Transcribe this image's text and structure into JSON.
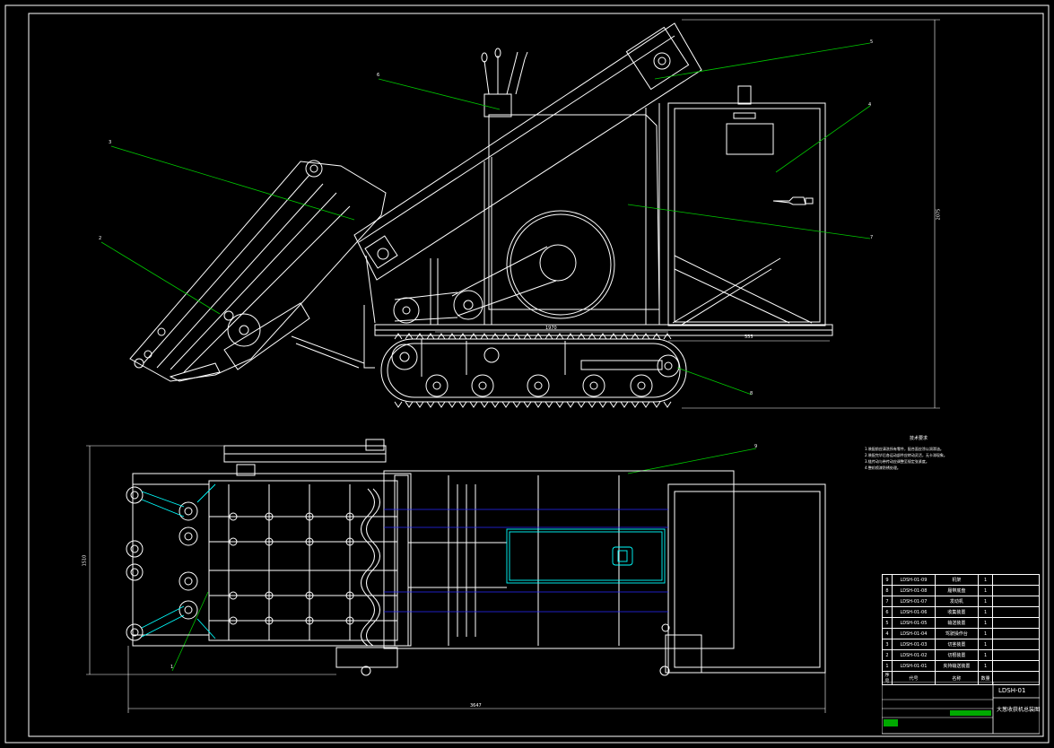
{
  "balloons": [
    "1",
    "2",
    "3",
    "4",
    "5",
    "6",
    "7",
    "8",
    "9"
  ],
  "dimensions": {
    "height_side": "2075",
    "track_len": "1970",
    "track_tail": "555",
    "height_top": "1510",
    "total_len": "3647"
  },
  "tech_notes": {
    "title": "技术要求",
    "lines": [
      "1.装配前应清洗所有零件，配合面应涂以润滑油。",
      "2.装配完毕后各运动部件应转动灵活，无卡滞现象。",
      "3.链传动与带传动应调整至规定张紧度。",
      "4.整机喷漆防锈处理。"
    ]
  },
  "bom": [
    {
      "no": "9",
      "code": "LDSH-01-09",
      "name": "机架",
      "qty": "1"
    },
    {
      "no": "8",
      "code": "LDSH-01-08",
      "name": "履带底盘",
      "qty": "1"
    },
    {
      "no": "7",
      "code": "LDSH-01-07",
      "name": "发动机",
      "qty": "1"
    },
    {
      "no": "6",
      "code": "LDSH-01-06",
      "name": "收集装置",
      "qty": "1"
    },
    {
      "no": "5",
      "code": "LDSH-01-05",
      "name": "输送装置",
      "qty": "1"
    },
    {
      "no": "4",
      "code": "LDSH-01-04",
      "name": "驾驶操作台",
      "qty": "1"
    },
    {
      "no": "3",
      "code": "LDSH-01-03",
      "name": "切茎装置",
      "qty": "1"
    },
    {
      "no": "2",
      "code": "LDSH-01-02",
      "name": "切根装置",
      "qty": "1"
    },
    {
      "no": "1",
      "code": "LDSH-01-01",
      "name": "夹持输送装置",
      "qty": "1"
    }
  ],
  "bom_header": {
    "no": "序号",
    "code": "代号",
    "name": "名称",
    "qty": "数量"
  },
  "drawing_no": "LDSH-01",
  "drawing_title": "大葱收获机总装图",
  "colors": {
    "line": "#ffffff",
    "leader": "#00c800",
    "hidden": "#0000ff",
    "highlight": "#00ffff",
    "background": "#000000"
  }
}
